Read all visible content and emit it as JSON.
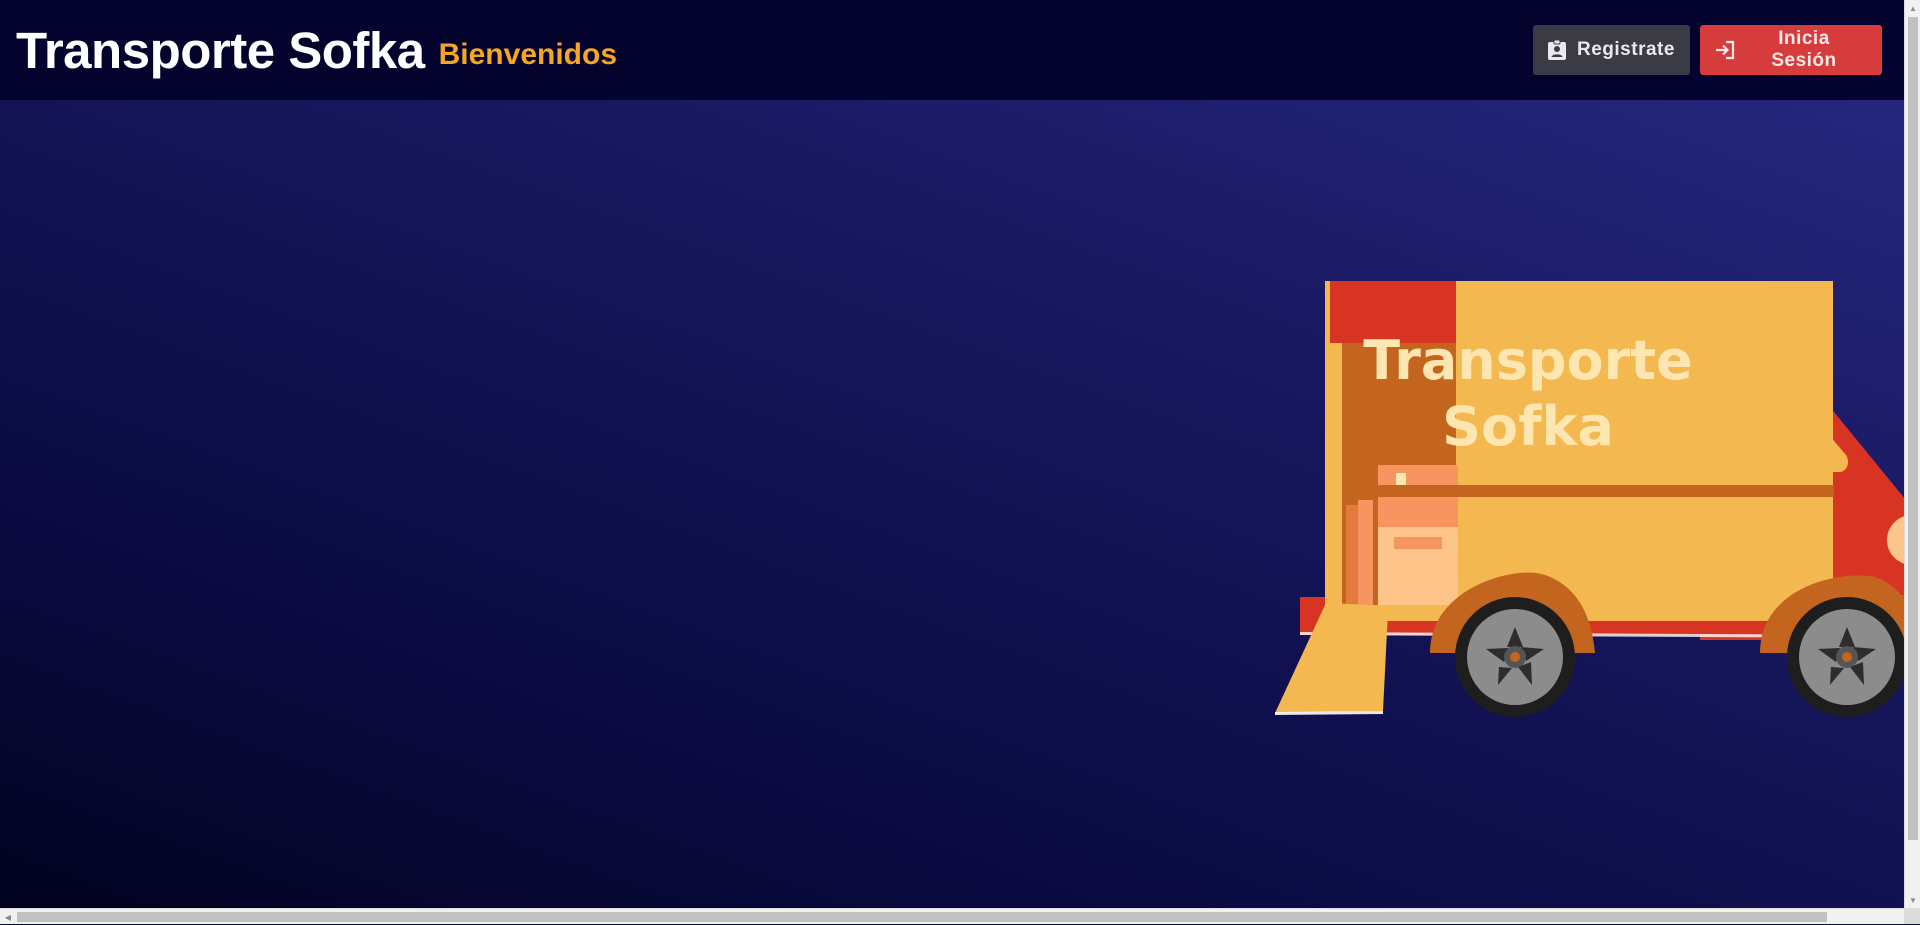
{
  "header": {
    "brand": "Transporte Sofka",
    "welcome": "Bienvenidos",
    "register_label": "Registrate",
    "login_label": "Inicia Sesión"
  },
  "hero": {
    "truck_line1": "Transporte",
    "truck_line2": "Sofka"
  },
  "colors": {
    "header_bg": "#03032e",
    "accent": "#f5a623",
    "register_bg": "#3b3b45",
    "login_bg": "#d63c3c",
    "truck_body": "#f3b84f",
    "truck_cab": "#d83424",
    "truck_text": "#fde6b0"
  },
  "icons": {
    "register": "contact-badge-icon",
    "login": "login-icon"
  }
}
